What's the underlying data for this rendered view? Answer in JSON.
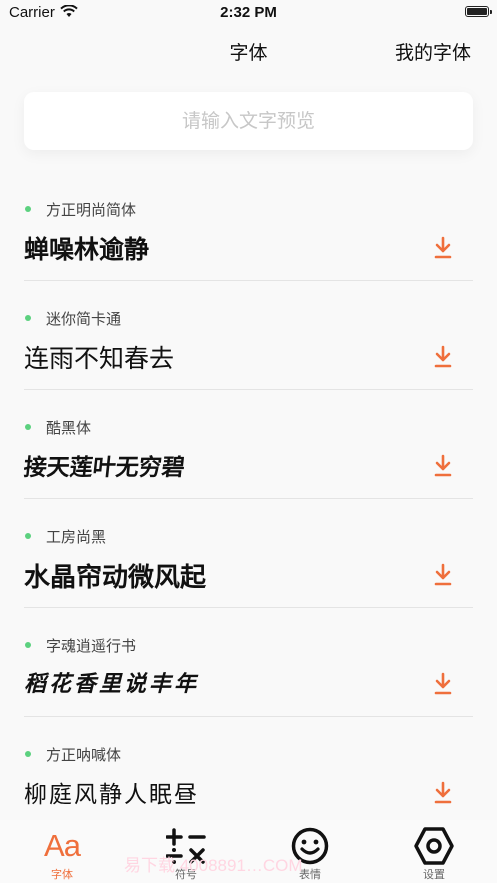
{
  "status_bar": {
    "carrier": "Carrier",
    "time": "2:32 PM"
  },
  "nav": {
    "title": "字体",
    "right_button": "我的字体"
  },
  "search": {
    "placeholder": "请输入文字预览"
  },
  "fonts": [
    {
      "name": "方正明尚简体",
      "preview": "蝉噪林逾静"
    },
    {
      "name": "迷你简卡通",
      "preview": "连雨不知春去"
    },
    {
      "name": "酷黑体",
      "preview": "接天莲叶无穷碧"
    },
    {
      "name": "工房尚黑",
      "preview": "水晶帘动微风起"
    },
    {
      "name": "字魂逍遥行书",
      "preview": "稻花香里说丰年"
    },
    {
      "name": "方正呐喊体",
      "preview": "柳庭风静人眠昼"
    }
  ],
  "tabs": [
    {
      "label": "字体",
      "icon": "Aa"
    },
    {
      "label": "符号",
      "icon": "math-symbols-icon"
    },
    {
      "label": "表情",
      "icon": "smiley-icon"
    },
    {
      "label": "设置",
      "icon": "gear-icon"
    }
  ],
  "watermark": "易下载 4008891…COM",
  "colors": {
    "accent": "#ef6f3c",
    "dot": "#5cd17f",
    "background": "#f9f9f9"
  }
}
